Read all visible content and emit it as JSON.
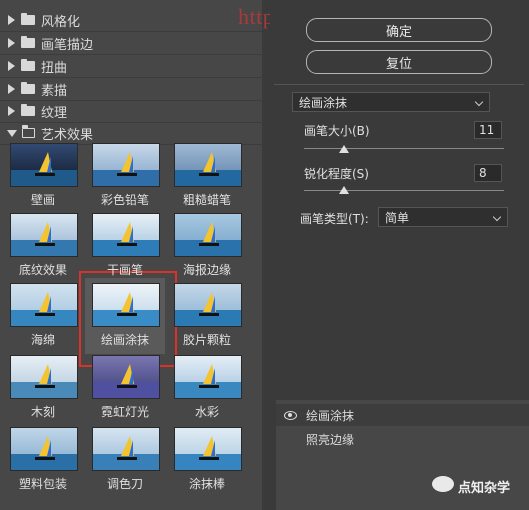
{
  "left_panel": {
    "categories": [
      {
        "label": "风格化",
        "expanded": false
      },
      {
        "label": "画笔描边",
        "expanded": false
      },
      {
        "label": "扭曲",
        "expanded": false
      },
      {
        "label": "素描",
        "expanded": false
      },
      {
        "label": "纹理",
        "expanded": false
      },
      {
        "label": "艺术效果",
        "expanded": true
      }
    ],
    "filters": [
      {
        "label": "壁画"
      },
      {
        "label": "彩色铅笔"
      },
      {
        "label": "粗糙蜡笔"
      },
      {
        "label": "底纹效果"
      },
      {
        "label": "干画笔"
      },
      {
        "label": "海报边缘"
      },
      {
        "label": "海绵"
      },
      {
        "label": "绘画涂抹",
        "selected": true
      },
      {
        "label": "胶片颗粒"
      },
      {
        "label": "木刻"
      },
      {
        "label": "霓虹灯光"
      },
      {
        "label": "水彩"
      },
      {
        "label": "塑料包装"
      },
      {
        "label": "调色刀"
      },
      {
        "label": "涂抹棒"
      }
    ]
  },
  "right_panel": {
    "ok_label": "确定",
    "reset_label": "复位",
    "filter_select": "绘画涂抹",
    "brush_size_label": "画笔大小(B)",
    "brush_size_value": "11",
    "sharpness_label": "锐化程度(S)",
    "sharpness_value": "8",
    "brush_type_label": "画笔类型(T):",
    "brush_type_value": "简单"
  },
  "layers": [
    {
      "label": "绘画涂抹",
      "visible": true
    },
    {
      "label": "照亮边缘",
      "visible": false
    }
  ],
  "watermark": {
    "url": "http://www.it.org...",
    "brand": "点知杂学"
  },
  "colors": {
    "accent_selection": "#d9322b",
    "panel_bg": "#474747",
    "main_bg": "#3a3a3a"
  }
}
